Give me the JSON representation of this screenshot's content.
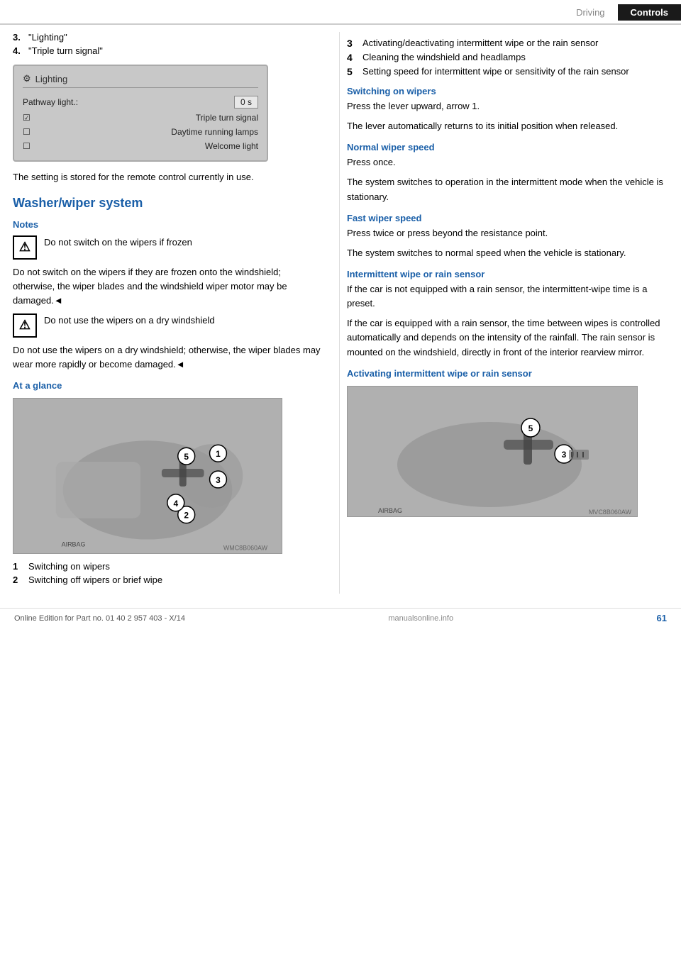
{
  "header": {
    "tab_driving": "Driving",
    "tab_controls": "Controls"
  },
  "left": {
    "list_items": [
      {
        "num": "3.",
        "text": "\"Lighting\""
      },
      {
        "num": "4.",
        "text": "\"Triple turn signal\""
      }
    ],
    "screen": {
      "title": "Lighting",
      "row1_label": "Pathway light.:",
      "row1_value": "0 s",
      "row2_label": "Triple turn signal",
      "row2_checked": true,
      "row3_label": "Daytime running lamps",
      "row3_checked": false,
      "row4_label": "Welcome light",
      "row4_checked": false
    },
    "caption": "The setting is stored for the remote control currently in use.",
    "section_heading": "Washer/wiper system",
    "notes_heading": "Notes",
    "warning1_short": "Do not switch on the wipers if frozen",
    "warning1_long": "Do not switch on the wipers if they are frozen onto the windshield; otherwise, the wiper blades and the windshield wiper motor may be damaged.◄",
    "warning2_short": "Do not use the wipers on a dry windshield",
    "warning2_long": "Do not use the wipers on a dry windshield; otherwise, the wiper blades may wear more rapidly or become damaged.◄",
    "at_a_glance_heading": "At a glance",
    "glance_items": [
      {
        "num": "1",
        "text": "Switching on wipers"
      },
      {
        "num": "2",
        "text": "Switching off wipers or brief wipe"
      }
    ]
  },
  "right": {
    "list_items": [
      {
        "num": "3",
        "text": "Activating/deactivating intermittent wipe or the rain sensor"
      },
      {
        "num": "4",
        "text": "Cleaning the windshield and headlamps"
      },
      {
        "num": "5",
        "text": "Setting speed for intermittent wipe or sensitivity of the rain sensor"
      }
    ],
    "switching_on_heading": "Switching on wipers",
    "switching_on_text1": "Press the lever upward, arrow 1.",
    "switching_on_text2": "The lever automatically returns to its initial position when released.",
    "normal_speed_heading": "Normal wiper speed",
    "normal_speed_text1": "Press once.",
    "normal_speed_text2": "The system switches to operation in the intermittent mode when the vehicle is stationary.",
    "fast_speed_heading": "Fast wiper speed",
    "fast_speed_text1": "Press twice or press beyond the resistance point.",
    "fast_speed_text2": "The system switches to normal speed when the vehicle is stationary.",
    "intermittent_heading": "Intermittent wipe or rain sensor",
    "intermittent_text1": "If the car is not equipped with a rain sensor, the intermittent-wipe time is a preset.",
    "intermittent_text2": "If the car is equipped with a rain sensor, the time between wipes is controlled automatically and depends on the intensity of the rainfall. The rain sensor is mounted on the windshield, directly in front of the interior rearview mirror.",
    "activating_heading": "Activating intermittent wipe or rain sensor",
    "image_label": "MVC8B060AW"
  },
  "footer": {
    "text": "Online Edition for Part no. 01 40 2 957 403 - X/14",
    "page": "61",
    "watermark": "manualsonline.info"
  }
}
